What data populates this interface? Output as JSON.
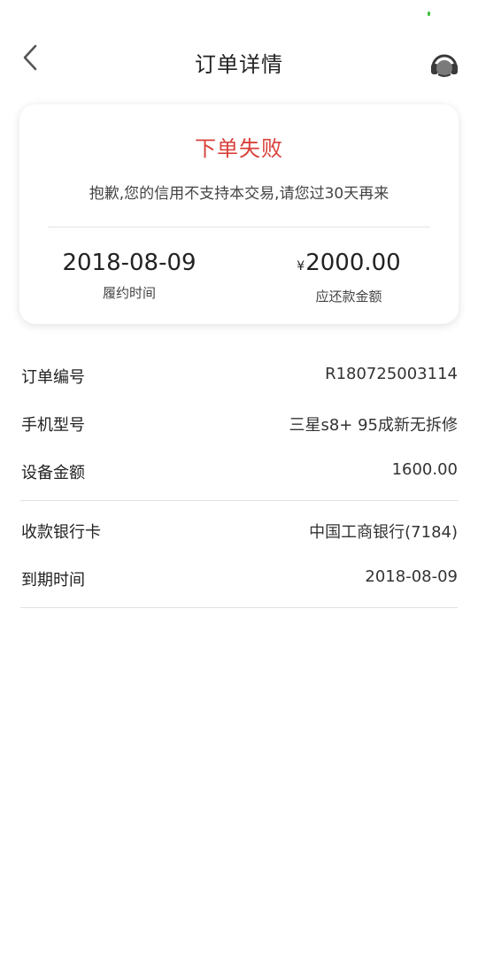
{
  "header": {
    "title": "订单详情"
  },
  "result_card": {
    "status": "下单失败",
    "message": "抱歉,您的信用不支持本交易,请您过30天再来",
    "due_date_value": "2018-08-09",
    "due_date_label": "履约时间",
    "amount_currency": "¥",
    "amount_value": "2000.00",
    "amount_label": "应还款金额"
  },
  "details": {
    "order_no_label": "订单编号",
    "order_no_value": "R180725003114",
    "phone_model_label": "手机型号",
    "phone_model_value": "三星s8+ 95成新无拆修",
    "device_amount_label": "设备金额",
    "device_amount_value": "1600.00",
    "bank_card_label": "收款银行卡",
    "bank_card_value": "中国工商银行(7184)",
    "expiry_label": "到期时间",
    "expiry_value": "2018-08-09"
  },
  "colors": {
    "status_red": "#d9403a",
    "status_bar_dot": "#3cc23c",
    "divider": "#e0e0e0"
  },
  "icons": {
    "back": "chevron-left-icon",
    "service": "headset-icon"
  }
}
